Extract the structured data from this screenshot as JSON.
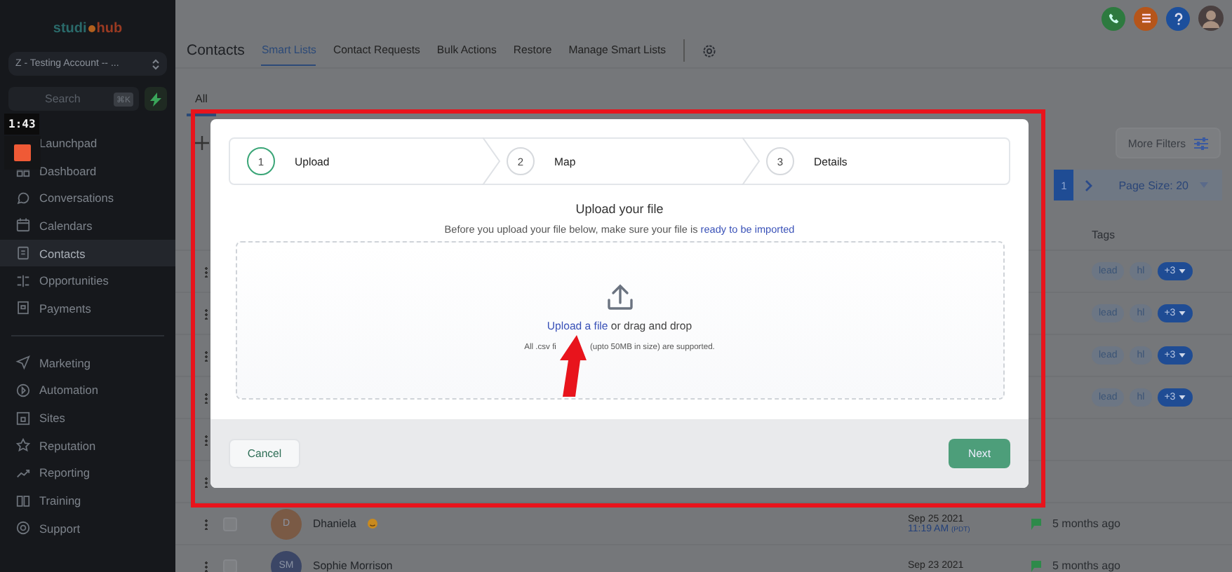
{
  "sidebar": {
    "logo": {
      "left": "studi",
      "right": "hub"
    },
    "account": "Z - Testing Account -- ...",
    "search": {
      "placeholder": "Search",
      "shortcut": "⌘K"
    },
    "nav": [
      {
        "label": "Launchpad",
        "selected": false
      },
      {
        "label": "Dashboard",
        "selected": false
      },
      {
        "label": "Conversations",
        "selected": false
      },
      {
        "label": "Calendars",
        "selected": false
      },
      {
        "label": "Contacts",
        "selected": true
      },
      {
        "label": "Opportunities",
        "selected": false
      },
      {
        "label": "Payments",
        "selected": false
      }
    ],
    "nav_secondary": [
      {
        "label": "Marketing",
        "selected": false
      },
      {
        "label": "Automation",
        "selected": false
      },
      {
        "label": "Sites",
        "selected": false
      },
      {
        "label": "Reputation",
        "selected": false
      },
      {
        "label": "Reporting",
        "selected": false
      },
      {
        "label": "Training",
        "selected": false
      },
      {
        "label": "Support",
        "selected": false
      }
    ]
  },
  "video_overlay": {
    "time": "1:43"
  },
  "header": {
    "title": "Contacts",
    "tabs": [
      {
        "label": "Smart Lists",
        "selected": true
      },
      {
        "label": "Contact Requests",
        "selected": false
      },
      {
        "label": "Bulk Actions",
        "selected": false
      },
      {
        "label": "Restore",
        "selected": false
      },
      {
        "label": "Manage Smart Lists",
        "selected": false
      }
    ]
  },
  "subtabs": [
    {
      "label": "All",
      "selected": true
    }
  ],
  "filters": {
    "more_filters": "More Filters"
  },
  "pagination": {
    "pages": [
      {
        "label": "1",
        "selected": true
      }
    ],
    "page_size": "Page Size: 20"
  },
  "table": {
    "tags_header": "Tags",
    "tag_rows": [
      {
        "tags": [
          "lead",
          "hl"
        ],
        "more": "+3"
      },
      {
        "tags": [
          "lead",
          "hl"
        ],
        "more": "+3"
      },
      {
        "tags": [
          "lead",
          "hl"
        ],
        "more": "+3"
      },
      {
        "tags": [
          "lead",
          "hl"
        ],
        "more": "+3"
      }
    ],
    "contacts": [
      {
        "initials": "D",
        "name": "Dhaniela",
        "emoji": true,
        "checked": false,
        "color": "#7a5a45",
        "date": "Sep 25 2021",
        "time": "11:19 AM",
        "zone": "(PDT)",
        "activity": "5 months ago"
      },
      {
        "initials": "SM",
        "name": "Sophie Morrison",
        "emoji": false,
        "checked": false,
        "color": "#3b4666",
        "date": "Sep 23 2021",
        "activity": "5 months ago"
      }
    ]
  },
  "modal": {
    "steps": [
      {
        "number": "1",
        "label": "Upload",
        "selected": true
      },
      {
        "number": "2",
        "label": "Map",
        "selected": false
      },
      {
        "number": "3",
        "label": "Details",
        "selected": false
      }
    ],
    "title": "Upload your file",
    "note": "Before you upload your file below, make sure your file is ",
    "note_link": "ready to be imported",
    "dropzone": {
      "link": "Upload a file",
      "text": " or drag and drop",
      "hint_before": "All .csv fi",
      "hint_after": "(upto 50MB in size) are supported."
    },
    "cancel": "Cancel",
    "next": "Next"
  }
}
